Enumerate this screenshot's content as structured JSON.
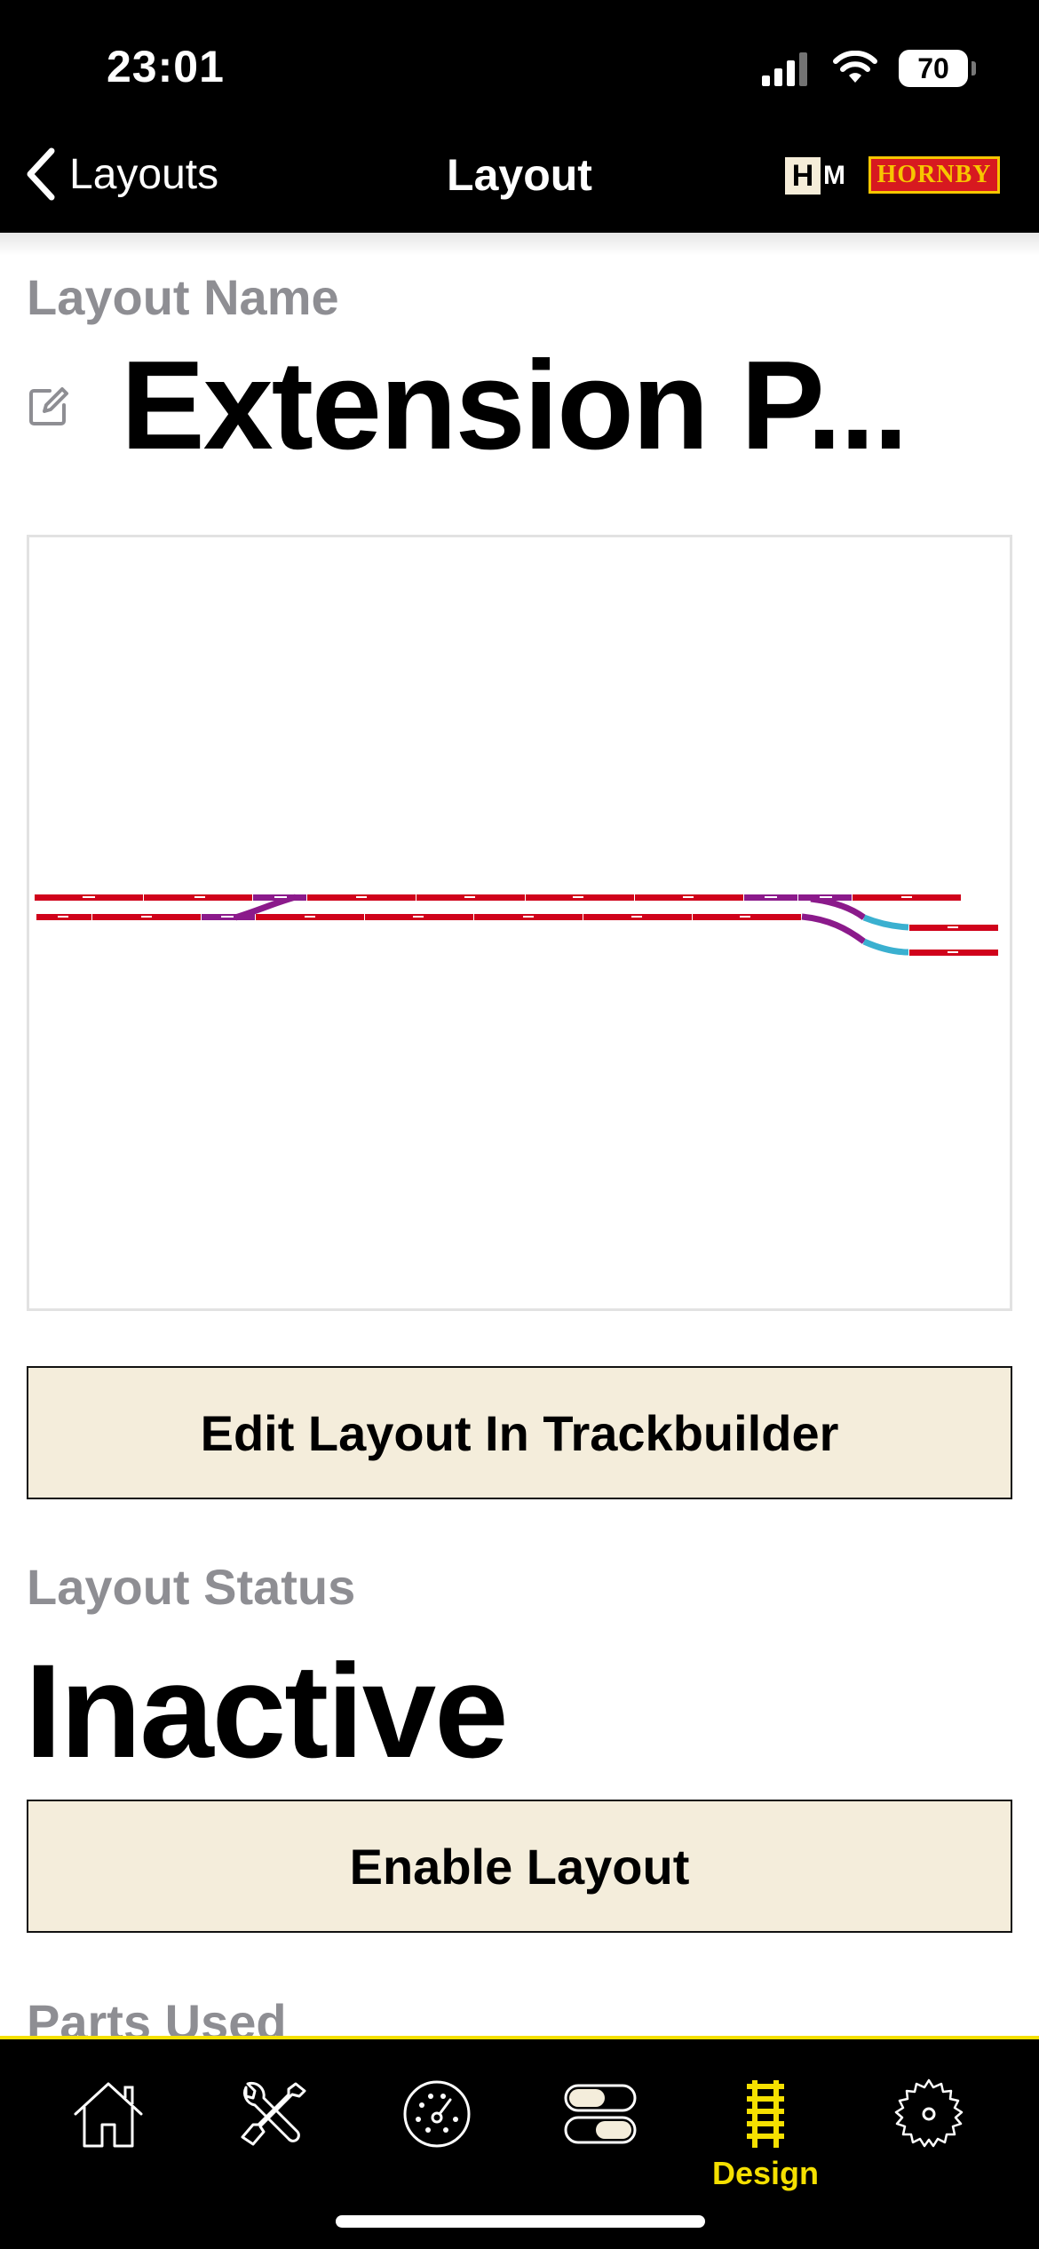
{
  "status_bar": {
    "time": "23:01",
    "battery": "70",
    "icons": [
      "cellular-signal-icon",
      "wifi-icon",
      "battery-icon"
    ]
  },
  "nav": {
    "back_label": "Layouts",
    "title": "Layout",
    "brands": {
      "hm_h": "H",
      "hm_m": "M",
      "hornby": "HORNBY"
    }
  },
  "layout": {
    "name_label": "Layout Name",
    "name": "Extension P...",
    "edit_button": "Edit Layout In Trackbuilder",
    "status_label": "Layout Status",
    "status": "Inactive",
    "enable_button": "Enable Layout",
    "parts_label": "Parts Used"
  },
  "track_preview": {
    "colors": {
      "straight": "#d0021b",
      "point": "#8b1a8b",
      "curve": "#3ab0d0"
    }
  },
  "tabs": [
    {
      "name": "home",
      "icon": "house-icon",
      "label": ""
    },
    {
      "name": "tools",
      "icon": "wrench-screwdriver-icon",
      "label": ""
    },
    {
      "name": "speed",
      "icon": "speedometer-icon",
      "label": ""
    },
    {
      "name": "controls",
      "icon": "toggles-icon",
      "label": ""
    },
    {
      "name": "design",
      "icon": "track-icon",
      "label": "Design",
      "active": true
    },
    {
      "name": "settings",
      "icon": "gear-icon",
      "label": ""
    }
  ],
  "theme": {
    "accent": "#f5e000",
    "button_bg": "#f4eddb",
    "label_gray": "#8e8e93"
  }
}
